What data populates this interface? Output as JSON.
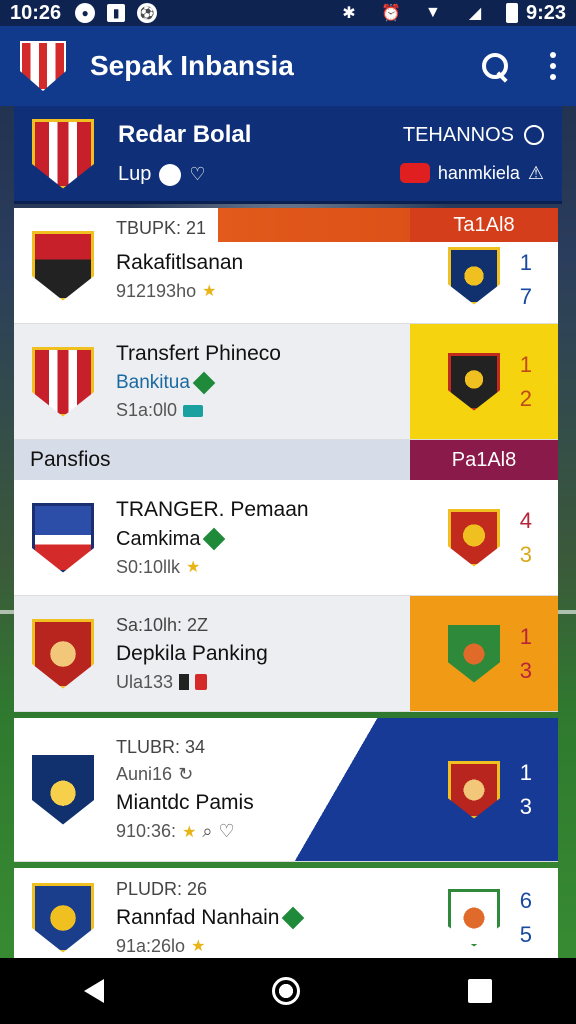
{
  "status_bar": {
    "time": "10:26",
    "right_time": "9:23"
  },
  "app_bar": {
    "title": "Sepak Inbansia"
  },
  "featured": {
    "name": "Redar Bolal",
    "sub": "Lup",
    "right_top": "TEHANNOS",
    "right_bottom": "hanmkiela"
  },
  "rows": [
    {
      "small": "TBUPK: 21",
      "title": "Rakafitlsanan",
      "meta": "912193ho",
      "banner": "Ta1Al8",
      "score": [
        "1",
        "7"
      ]
    },
    {
      "title": "Transfert Phineco",
      "blue": "Bankitua",
      "meta": "S1a:0l0",
      "score": [
        "1",
        "2"
      ]
    },
    {
      "title": "TRANGER. Pemaan",
      "sub": "Camkima",
      "meta": "S0:10llk",
      "score": [
        "4",
        "3"
      ]
    },
    {
      "small": "Sa:10lh: 2Z",
      "title": "Depkila Panking",
      "meta": "Ula133",
      "score": [
        "1",
        "3"
      ]
    },
    {
      "small": "TLUBR: 34",
      "sub": "Auni16",
      "title": "Miantdc Pamis",
      "meta": "910:36:",
      "score": [
        "1",
        "3"
      ]
    },
    {
      "small": "PLUDR: 26",
      "title": "Rannfad Nanhain",
      "meta": "91a:26lo",
      "score": [
        "6",
        "5"
      ]
    }
  ],
  "section": {
    "label": "Pansfios",
    "right": "Pa1Al8"
  },
  "colors": {
    "primary": "#123a8c",
    "accent_orange": "#e25a1c",
    "accent_yellow": "#f5d30f",
    "section_badge": "#8a1a4a"
  }
}
